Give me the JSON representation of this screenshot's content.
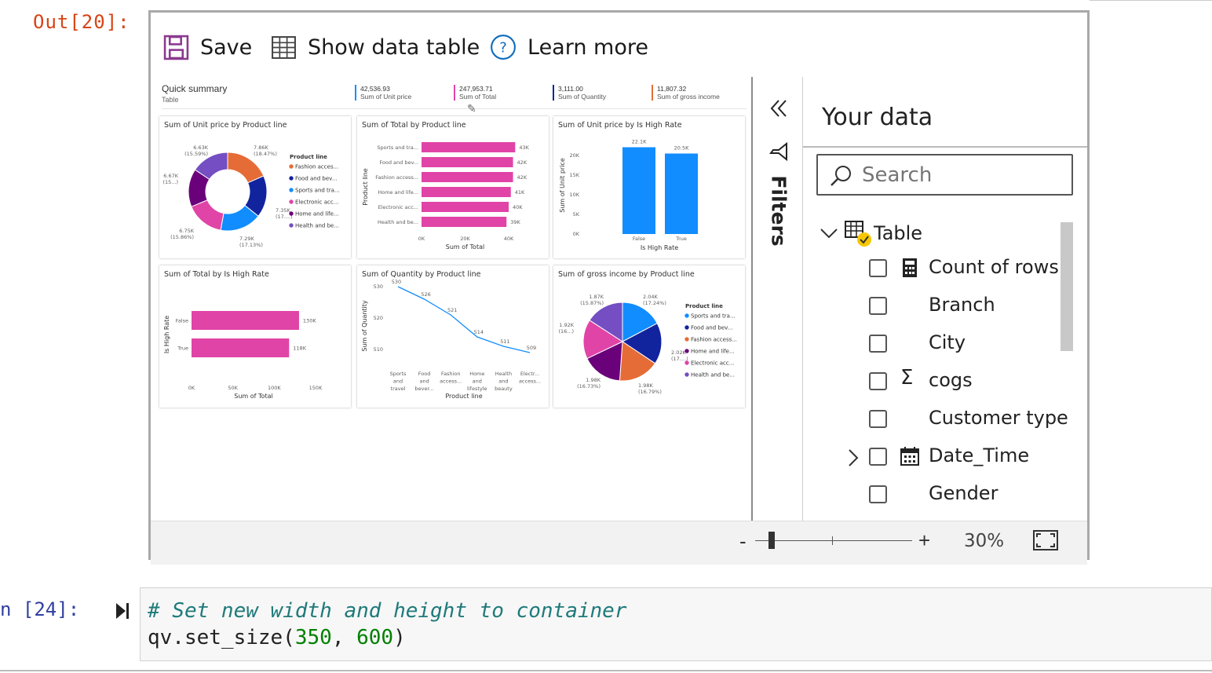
{
  "out_prompt": "Out[20]:",
  "toolbar": {
    "save": "Save",
    "show_table": "Show data table",
    "learn_more": "Learn more"
  },
  "summary": {
    "title": "Quick summary",
    "subtitle": "Table",
    "kpis": [
      {
        "value": "42,536.93",
        "label": "Sum of Unit price",
        "color": "#118dff"
      },
      {
        "value": "247,953.71",
        "label": "Sum of Total",
        "color": "#e044a7"
      },
      {
        "value": "3,111.00",
        "label": "Sum of Quantity",
        "color": "#12239e"
      },
      {
        "value": "11,807.32",
        "label": "Sum of gross income",
        "color": "#e66c37"
      }
    ]
  },
  "chart_data": [
    {
      "type": "pie",
      "donut": true,
      "title": "Sum of Unit price by Product line",
      "legend_title": "Product line",
      "legend": [
        "Fashion acces...",
        "Food and bev...",
        "Sports and tra...",
        "Electronic acc...",
        "Home and life...",
        "Health and be..."
      ],
      "labels": [
        "7.86K (18.47%)",
        "7.35K (17....)",
        "7.29K (17.13%)",
        "6.75K (15.86%)",
        "6.67K (15...)",
        "6.63K (15.59%)"
      ],
      "values": [
        7.86,
        7.35,
        7.29,
        6.75,
        6.67,
        6.63
      ],
      "colors": [
        "#e66c37",
        "#12239e",
        "#118dff",
        "#e044a7",
        "#6b007b",
        "#744ec2"
      ]
    },
    {
      "type": "bar",
      "orientation": "horizontal",
      "title": "Sum of Total by Product line",
      "categories": [
        "Sports and tra...",
        "Food and bev...",
        "Fashion access...",
        "Home and life...",
        "Electronic acc...",
        "Health and be..."
      ],
      "values": [
        43,
        42,
        42,
        41,
        40,
        39
      ],
      "value_labels": [
        "43K",
        "42K",
        "42K",
        "41K",
        "40K",
        "39K"
      ],
      "xlabel": "Sum of Total",
      "ylabel": "Product line",
      "ticks": [
        "0K",
        "20K",
        "40K"
      ],
      "xlim": [
        0,
        40
      ],
      "color": "#e044a7"
    },
    {
      "type": "bar",
      "title": "Sum of Unit price by Is High Rate",
      "categories": [
        "False",
        "True"
      ],
      "values": [
        22.1,
        20.5
      ],
      "value_labels": [
        "22.1K",
        "20.5K"
      ],
      "xlabel": "Is High Rate",
      "ylabel": "Sum of Unit price",
      "ticks": [
        "0K",
        "5K",
        "10K",
        "15K",
        "20K"
      ],
      "ylim": [
        0,
        20
      ],
      "color": "#118dff"
    },
    {
      "type": "bar",
      "orientation": "horizontal",
      "title": "Sum of Total by Is High Rate",
      "categories": [
        "False",
        "True"
      ],
      "values": [
        130,
        118
      ],
      "value_labels": [
        "130K",
        "118K"
      ],
      "xlabel": "Sum of Total",
      "ylabel": "Is High Rate",
      "ticks": [
        "0K",
        "50K",
        "100K",
        "150K"
      ],
      "xlim": [
        0,
        150
      ],
      "color": "#e044a7"
    },
    {
      "type": "line",
      "title": "Sum of Quantity by Product line",
      "categories": [
        "Sports and travel",
        "Food and bever...",
        "Fashion access...",
        "Home and lifestyle",
        "Health and beauty",
        "Electr... access..."
      ],
      "values": [
        530,
        526,
        521,
        514,
        511,
        509
      ],
      "xlabel": "Product line",
      "ylabel": "Sum of Quantity",
      "ticks": [
        "510",
        "520",
        "530"
      ],
      "ylim": [
        510,
        530
      ],
      "color": "#118dff"
    },
    {
      "type": "pie",
      "title": "Sum of gross income by Product line",
      "legend_title": "Product line",
      "legend": [
        "Sports and tra...",
        "Food and bev...",
        "Fashion access...",
        "Home and life...",
        "Electronic acc...",
        "Health and be..."
      ],
      "labels": [
        "2.04K (17.24%)",
        "2.02K (17....)",
        "1.98K (16.79%)",
        "1.98K (16.73%)",
        "1.92K (16...)",
        "1.87K (15.87%)"
      ],
      "values": [
        2.04,
        2.02,
        1.98,
        1.98,
        1.92,
        1.87
      ],
      "colors": [
        "#118dff",
        "#12239e",
        "#e66c37",
        "#6b007b",
        "#e044a7",
        "#744ec2"
      ]
    }
  ],
  "filters_label": "Filters",
  "your_data": {
    "title": "Your data",
    "search_placeholder": "Search",
    "table_name": "Table",
    "fields": [
      "Count of rows",
      "Branch",
      "City",
      "cogs",
      "Customer type",
      "Date_Time",
      "Gender"
    ]
  },
  "zoom": {
    "minus": "-",
    "plus": "+",
    "value": "30%"
  },
  "code_cell": {
    "prompt": "n [24]:",
    "comment": "# Set new width and height to container",
    "code_prefix": "qv.set_size(",
    "arg1": "350",
    "sep": ", ",
    "arg2": "600",
    "code_suffix": ")"
  }
}
